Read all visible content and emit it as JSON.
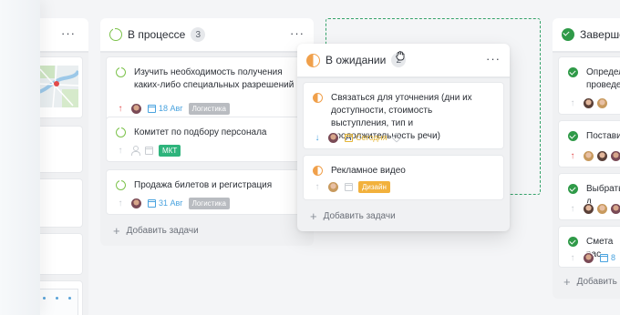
{
  "board": {
    "prev_column": {
      "menu_icon": "more-dots-icon"
    },
    "in_progress": {
      "title": "В процессе",
      "count": "3",
      "cards": [
        {
          "title": "Изучить необходимость получения каких-либо специальных разрешений",
          "priority": "up",
          "date": "18 Авг",
          "tag": "Логистика"
        },
        {
          "title": "Комитет по подбору персонала",
          "tag": "МКТ"
        },
        {
          "title": "Продажа билетов и регистрация",
          "date": "31 Авг",
          "tag": "Логистика"
        }
      ],
      "add_label": "Добавить задачи"
    },
    "waiting": {
      "title": "В ожидании",
      "count": "2",
      "cards": [
        {
          "title": "Связаться для уточнения (дни их доступности, стоимость выступления, тип и продолжительность речи)",
          "priority": "down",
          "date": "Сегодня"
        },
        {
          "title": "Рекламное видео",
          "tag": "Дизайн"
        }
      ],
      "add_label": "Добавить задачи"
    },
    "done": {
      "title": "Заверше",
      "cards": [
        {
          "title_line1": "Определи",
          "title_line2": "проведен"
        },
        {
          "title": "Поставит"
        },
        {
          "title": "Выбрать д"
        },
        {
          "title": "Смета рас",
          "date": "8"
        }
      ],
      "add_label": "Добавить"
    }
  },
  "colors": {
    "progress": "#7cc24b",
    "waiting": "#f0a04b",
    "done": "#2f9a48",
    "tag_logistics": "#b9bcc1",
    "tag_mkt": "#2eb47c",
    "tag_design": "#f2b13c",
    "drop_outline": "#35a36a"
  }
}
